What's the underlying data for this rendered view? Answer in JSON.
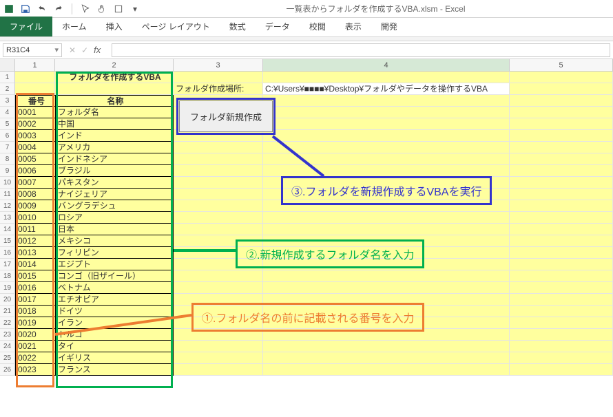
{
  "window": {
    "title": "一覧表からフォルダを作成するVBA.xlsm - Excel"
  },
  "ribbon": {
    "tabs": [
      "ファイル",
      "ホーム",
      "挿入",
      "ページ レイアウト",
      "数式",
      "データ",
      "校閲",
      "表示",
      "開発"
    ],
    "active_index": 0
  },
  "namebox": {
    "value": "R31C4"
  },
  "columns": [
    "1",
    "2",
    "3",
    "4",
    "5"
  ],
  "selected_col_index": 3,
  "sheet": {
    "title_cell": "フォルダを作成するVBA",
    "path_label": "フォルダ作成場所:",
    "path_value": "C:¥Users¥■■■■¥Desktop¥フォルダやデータを操作するVBA",
    "header_num": "番号",
    "header_name": "名称",
    "rows": [
      {
        "num": "0001",
        "name": "フォルダ名"
      },
      {
        "num": "0002",
        "name": "中国"
      },
      {
        "num": "0003",
        "name": "インド"
      },
      {
        "num": "0004",
        "name": "アメリカ"
      },
      {
        "num": "0005",
        "name": "インドネシア"
      },
      {
        "num": "0006",
        "name": "ブラジル"
      },
      {
        "num": "0007",
        "name": "パキスタン"
      },
      {
        "num": "0008",
        "name": "ナイジェリア"
      },
      {
        "num": "0009",
        "name": "バングラデシュ"
      },
      {
        "num": "0010",
        "name": "ロシア"
      },
      {
        "num": "0011",
        "name": "日本"
      },
      {
        "num": "0012",
        "name": "メキシコ"
      },
      {
        "num": "0013",
        "name": "フィリピン"
      },
      {
        "num": "0014",
        "name": "エジプト"
      },
      {
        "num": "0015",
        "name": "コンゴ（旧ザイール）"
      },
      {
        "num": "0016",
        "name": "ベトナム"
      },
      {
        "num": "0017",
        "name": "エチオピア"
      },
      {
        "num": "0018",
        "name": "ドイツ"
      },
      {
        "num": "0019",
        "name": "イラン"
      },
      {
        "num": "0020",
        "name": "トルコ"
      },
      {
        "num": "0021",
        "name": "タイ"
      },
      {
        "num": "0022",
        "name": "イギリス"
      },
      {
        "num": "0023",
        "name": "フランス"
      }
    ]
  },
  "macro_button": {
    "label": "フォルダ新規作成"
  },
  "annotations": {
    "step1": "①.フォルダ名の前に記載される番号を入力",
    "step2": "②.新規作成するフォルダ名を入力",
    "step3": "③.フォルダを新規作成するVBAを実行"
  },
  "colors": {
    "accent_green": "#217346",
    "hl_orange": "#ed7d31",
    "hl_green": "#00b050",
    "hl_blue": "#3333cc",
    "cell_yellow": "#ffff9e"
  }
}
